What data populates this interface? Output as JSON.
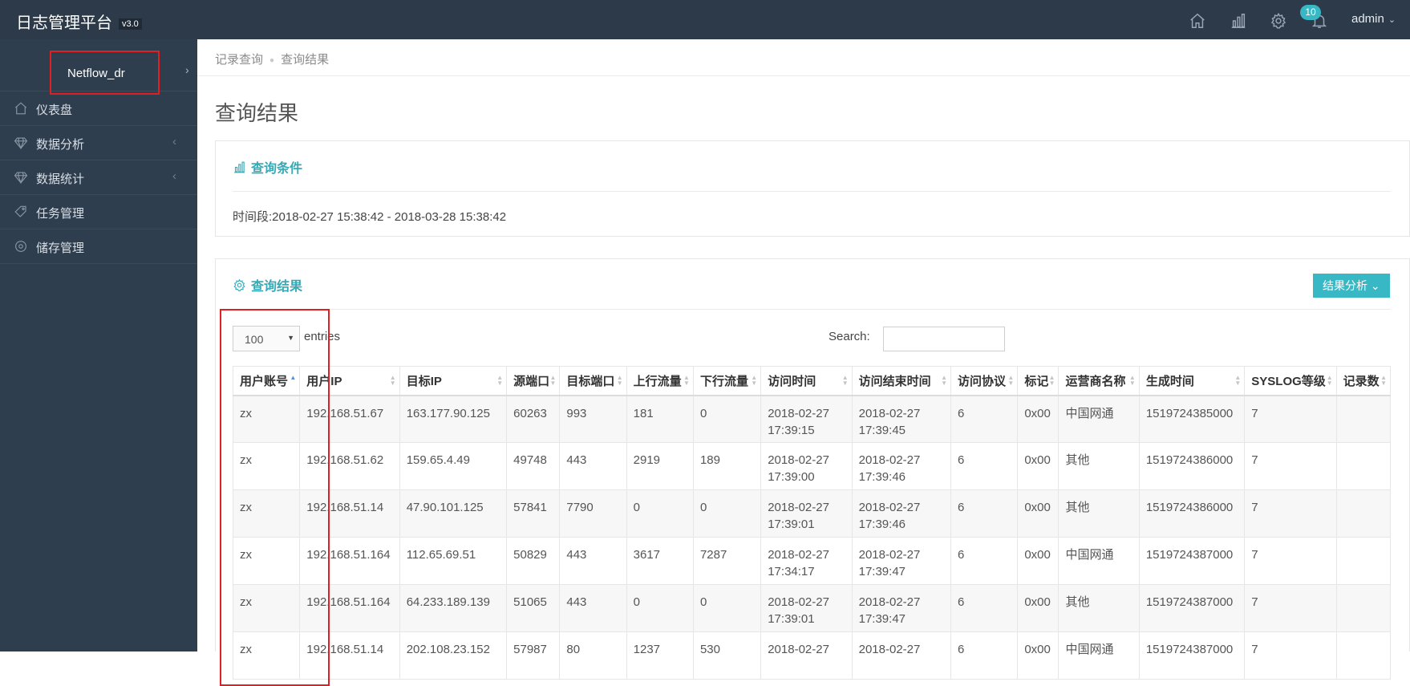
{
  "app": {
    "title": "日志管理平台",
    "version": "v3.0",
    "notification_count": "10",
    "user": "admin",
    "accent": "#37b8c4",
    "sidebar_bg": "#2f3e4e",
    "topbar_bg": "#2c3a4a",
    "highlight": "#e02020"
  },
  "topbar": {
    "icons": [
      "home-icon",
      "bar-chart-icon",
      "gear-icon",
      "bell-icon"
    ]
  },
  "sidebar": {
    "header": "Netflow_dr",
    "items": [
      {
        "label": "仪表盘",
        "icon": "home-icon",
        "has_children": false
      },
      {
        "label": "数据分析",
        "icon": "diamond-icon",
        "has_children": true
      },
      {
        "label": "数据统计",
        "icon": "diamond-icon",
        "has_children": true
      },
      {
        "label": "任务管理",
        "icon": "tag-icon",
        "has_children": false
      },
      {
        "label": "储存管理",
        "icon": "gear-icon",
        "has_children": false
      }
    ]
  },
  "breadcrumb": [
    "记录查询",
    "查询结果"
  ],
  "page_title": "查询结果",
  "condition_panel": {
    "title": "查询条件",
    "text": "时间段:2018-02-27 15:38:42 - 2018-03-28 15:38:42"
  },
  "result_panel": {
    "title": "查询结果",
    "analyze_button": "结果分析",
    "page_length": "100",
    "entries_label": "entries",
    "search_label": "Search:",
    "search_value": ""
  },
  "table": {
    "columns": [
      "用户账号",
      "用户IP",
      "目标IP",
      "源端口",
      "目标端口",
      "上行流量",
      "下行流量",
      "访问时间",
      "访问结束时间",
      "访问协议",
      "标记",
      "运营商名称",
      "生成时间",
      "SYSLOG等级",
      "记录数"
    ],
    "rows": [
      [
        "zx",
        "192.168.51.67",
        "163.177.90.125",
        "60263",
        "993",
        "181",
        "0",
        "2018-02-27\n17:39:15",
        "2018-02-27\n17:39:45",
        "6",
        "0x00",
        "中国网通",
        "1519724385000",
        "7",
        ""
      ],
      [
        "zx",
        "192.168.51.62",
        "159.65.4.49",
        "49748",
        "443",
        "2919",
        "189",
        "2018-02-27\n17:39:00",
        "2018-02-27\n17:39:46",
        "6",
        "0x00",
        "其他",
        "1519724386000",
        "7",
        ""
      ],
      [
        "zx",
        "192.168.51.14",
        "47.90.101.125",
        "57841",
        "7790",
        "0",
        "0",
        "2018-02-27\n17:39:01",
        "2018-02-27\n17:39:46",
        "6",
        "0x00",
        "其他",
        "1519724386000",
        "7",
        ""
      ],
      [
        "zx",
        "192.168.51.164",
        "112.65.69.51",
        "50829",
        "443",
        "3617",
        "7287",
        "2018-02-27\n17:34:17",
        "2018-02-27\n17:39:47",
        "6",
        "0x00",
        "中国网通",
        "1519724387000",
        "7",
        ""
      ],
      [
        "zx",
        "192.168.51.164",
        "64.233.189.139",
        "51065",
        "443",
        "0",
        "0",
        "2018-02-27\n17:39:01",
        "2018-02-27\n17:39:47",
        "6",
        "0x00",
        "其他",
        "1519724387000",
        "7",
        ""
      ],
      [
        "zx",
        "192.168.51.14",
        "202.108.23.152",
        "57987",
        "80",
        "1237",
        "530",
        "2018-02-27",
        "2018-02-27",
        "6",
        "0x00",
        "中国网通",
        "1519724387000",
        "7",
        ""
      ]
    ]
  }
}
